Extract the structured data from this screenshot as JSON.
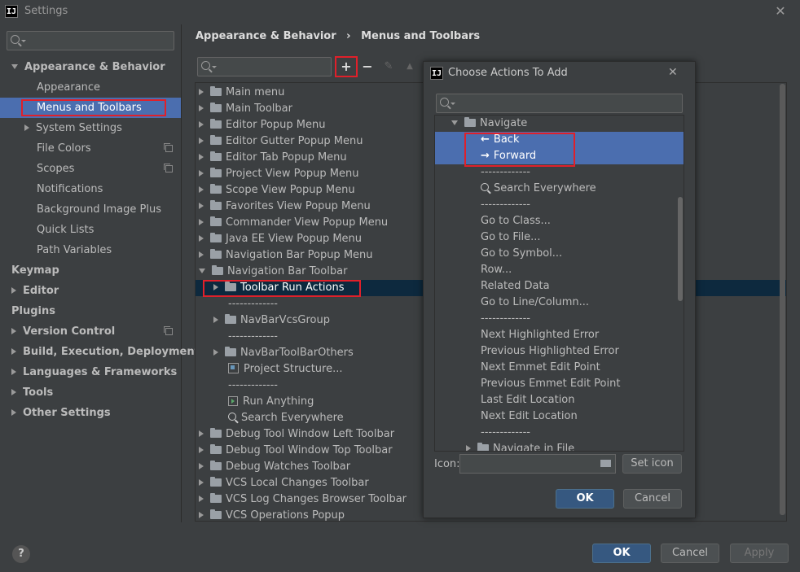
{
  "window": {
    "title": "Settings",
    "logo": "IJ"
  },
  "sidebar": {
    "search_placeholder": "",
    "items": [
      {
        "label": "Appearance & Behavior",
        "level": 0,
        "expand": "down",
        "bold": true
      },
      {
        "label": "Appearance",
        "level": 1
      },
      {
        "label": "Menus and Toolbars",
        "level": 1,
        "selected": true
      },
      {
        "label": "System Settings",
        "level": 1,
        "expand": "right"
      },
      {
        "label": "File Colors",
        "level": 1,
        "copy": true
      },
      {
        "label": "Scopes",
        "level": 1,
        "copy": true
      },
      {
        "label": "Notifications",
        "level": 1
      },
      {
        "label": "Background Image Plus",
        "level": 1
      },
      {
        "label": "Quick Lists",
        "level": 1
      },
      {
        "label": "Path Variables",
        "level": 1
      },
      {
        "label": "Keymap",
        "level": 0,
        "bold": true
      },
      {
        "label": "Editor",
        "level": 0,
        "expand": "right",
        "bold": true
      },
      {
        "label": "Plugins",
        "level": 0,
        "bold": true
      },
      {
        "label": "Version Control",
        "level": 0,
        "expand": "right",
        "bold": true,
        "copy": true
      },
      {
        "label": "Build, Execution, Deployment",
        "level": 0,
        "expand": "right",
        "bold": true
      },
      {
        "label": "Languages & Frameworks",
        "level": 0,
        "expand": "right",
        "bold": true
      },
      {
        "label": "Tools",
        "level": 0,
        "expand": "right",
        "bold": true
      },
      {
        "label": "Other Settings",
        "level": 0,
        "expand": "right",
        "bold": true
      }
    ]
  },
  "breadcrumb": {
    "parent": "Appearance & Behavior",
    "separator": "›",
    "current": "Menus and Toolbars"
  },
  "toolbar": {
    "add": "+",
    "remove": "−"
  },
  "tree": [
    {
      "label": "Main menu",
      "level": 0,
      "expand": "right",
      "icon": "folder"
    },
    {
      "label": "Main Toolbar",
      "level": 0,
      "expand": "right",
      "icon": "folder"
    },
    {
      "label": "Editor Popup Menu",
      "level": 0,
      "expand": "right",
      "icon": "folder"
    },
    {
      "label": "Editor Gutter Popup Menu",
      "level": 0,
      "expand": "right",
      "icon": "folder"
    },
    {
      "label": "Editor Tab Popup Menu",
      "level": 0,
      "expand": "right",
      "icon": "folder"
    },
    {
      "label": "Project View Popup Menu",
      "level": 0,
      "expand": "right",
      "icon": "folder"
    },
    {
      "label": "Scope View Popup Menu",
      "level": 0,
      "expand": "right",
      "icon": "folder"
    },
    {
      "label": "Favorites View Popup Menu",
      "level": 0,
      "expand": "right",
      "icon": "folder"
    },
    {
      "label": "Commander View Popup Menu",
      "level": 0,
      "expand": "right",
      "icon": "folder"
    },
    {
      "label": "Java EE View Popup Menu",
      "level": 0,
      "expand": "right",
      "icon": "folder"
    },
    {
      "label": "Navigation Bar Popup Menu",
      "level": 0,
      "expand": "right",
      "icon": "folder"
    },
    {
      "label": "Navigation Bar Toolbar",
      "level": 0,
      "expand": "down",
      "icon": "folder"
    },
    {
      "label": "Toolbar Run Actions",
      "level": 1,
      "expand": "right",
      "icon": "folder",
      "selected": true
    },
    {
      "label": "-------------",
      "level": 1,
      "separator": true
    },
    {
      "label": "NavBarVcsGroup",
      "level": 1,
      "expand": "right",
      "icon": "folder"
    },
    {
      "label": "-------------",
      "level": 1,
      "separator": true
    },
    {
      "label": "NavBarToolBarOthers",
      "level": 1,
      "expand": "right",
      "icon": "folder"
    },
    {
      "label": "Project Structure...",
      "level": 1,
      "icon": "project"
    },
    {
      "label": "-------------",
      "level": 1,
      "separator": true
    },
    {
      "label": "Run Anything",
      "level": 1,
      "icon": "run"
    },
    {
      "label": "Search Everywhere",
      "level": 1,
      "icon": "search"
    },
    {
      "label": "Debug Tool Window Left Toolbar",
      "level": 0,
      "expand": "right",
      "icon": "folder"
    },
    {
      "label": "Debug Tool Window Top Toolbar",
      "level": 0,
      "expand": "right",
      "icon": "folder"
    },
    {
      "label": "Debug Watches Toolbar",
      "level": 0,
      "expand": "right",
      "icon": "folder"
    },
    {
      "label": "VCS Local Changes Toolbar",
      "level": 0,
      "expand": "right",
      "icon": "folder"
    },
    {
      "label": "VCS Log Changes Browser Toolbar",
      "level": 0,
      "expand": "right",
      "icon": "folder"
    },
    {
      "label": "VCS Operations Popup",
      "level": 0,
      "expand": "right",
      "icon": "folder"
    }
  ],
  "footer": {
    "ok": "OK",
    "cancel": "Cancel",
    "apply": "Apply",
    "help": "?"
  },
  "dialog": {
    "title": "Choose Actions To Add",
    "logo": "IJ",
    "close": "✕",
    "search_placeholder": "",
    "list": [
      {
        "label": "Navigate",
        "level": 0,
        "expand": "down",
        "icon": "folder"
      },
      {
        "label": "Back",
        "level": 1,
        "icon": "arrow-left",
        "selected": true
      },
      {
        "label": "Forward",
        "level": 1,
        "icon": "arrow-right",
        "selected": true
      },
      {
        "label": "-------------",
        "level": 1
      },
      {
        "label": "Search Everywhere",
        "level": 1,
        "icon": "search"
      },
      {
        "label": "-------------",
        "level": 1
      },
      {
        "label": "Go to Class...",
        "level": 1
      },
      {
        "label": "Go to File...",
        "level": 1
      },
      {
        "label": "Go to Symbol...",
        "level": 1
      },
      {
        "label": "Row...",
        "level": 1
      },
      {
        "label": "Related Data",
        "level": 1
      },
      {
        "label": "Go to Line/Column...",
        "level": 1
      },
      {
        "label": "-------------",
        "level": 1
      },
      {
        "label": "Next Highlighted Error",
        "level": 1
      },
      {
        "label": "Previous Highlighted Error",
        "level": 1
      },
      {
        "label": "Next Emmet Edit Point",
        "level": 1
      },
      {
        "label": "Previous Emmet Edit Point",
        "level": 1
      },
      {
        "label": "Last Edit Location",
        "level": 1
      },
      {
        "label": "Next Edit Location",
        "level": 1
      },
      {
        "label": "-------------",
        "level": 1
      },
      {
        "label": "Navigate in File",
        "level": 1,
        "expand": "right",
        "icon": "folder"
      }
    ],
    "icon_label": "Icon:",
    "icon_value": "",
    "set_icon": "Set icon",
    "ok": "OK",
    "cancel": "Cancel"
  },
  "colors": {
    "selection": "#4b6eaf",
    "tree_selection": "#0d293e",
    "highlight_box": "#e0202a",
    "primary_button": "#365880"
  }
}
